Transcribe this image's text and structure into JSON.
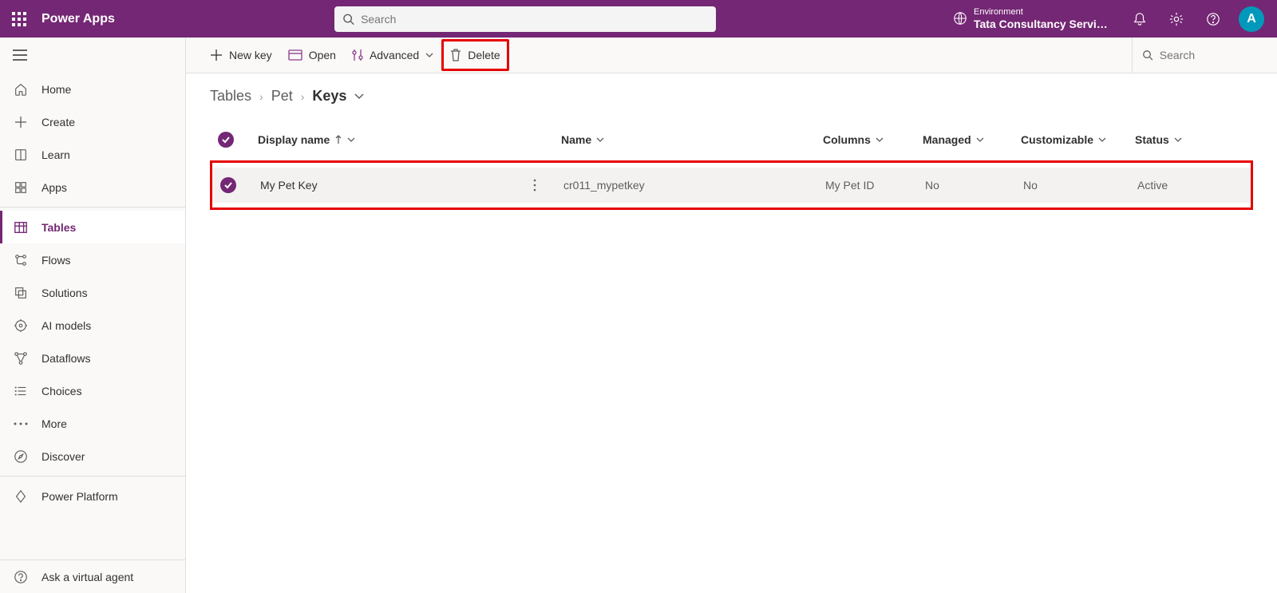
{
  "topbar": {
    "title": "Power Apps",
    "search_placeholder": "Search",
    "env_label": "Environment",
    "env_name": "Tata Consultancy Servic…",
    "avatar_initial": "A"
  },
  "sidebar": {
    "items": [
      {
        "id": "home",
        "label": "Home"
      },
      {
        "id": "create",
        "label": "Create"
      },
      {
        "id": "learn",
        "label": "Learn"
      },
      {
        "id": "apps",
        "label": "Apps"
      },
      {
        "id": "tables",
        "label": "Tables"
      },
      {
        "id": "flows",
        "label": "Flows"
      },
      {
        "id": "solutions",
        "label": "Solutions"
      },
      {
        "id": "aimodels",
        "label": "AI models"
      },
      {
        "id": "dataflows",
        "label": "Dataflows"
      },
      {
        "id": "choices",
        "label": "Choices"
      },
      {
        "id": "more",
        "label": "More"
      },
      {
        "id": "discover",
        "label": "Discover"
      }
    ],
    "power_platform": "Power Platform",
    "ask_agent": "Ask a virtual agent"
  },
  "commandbar": {
    "new_key": "New key",
    "open": "Open",
    "advanced": "Advanced",
    "delete": "Delete",
    "search_placeholder": "Search"
  },
  "breadcrumb": {
    "root": "Tables",
    "mid": "Pet",
    "current": "Keys"
  },
  "table": {
    "columns": {
      "display_name": "Display name",
      "name": "Name",
      "columns": "Columns",
      "managed": "Managed",
      "customizable": "Customizable",
      "status": "Status"
    },
    "rows": [
      {
        "display_name": "My Pet Key",
        "name": "cr011_mypetkey",
        "columns": "My Pet ID",
        "managed": "No",
        "customizable": "No",
        "status": "Active"
      }
    ]
  }
}
